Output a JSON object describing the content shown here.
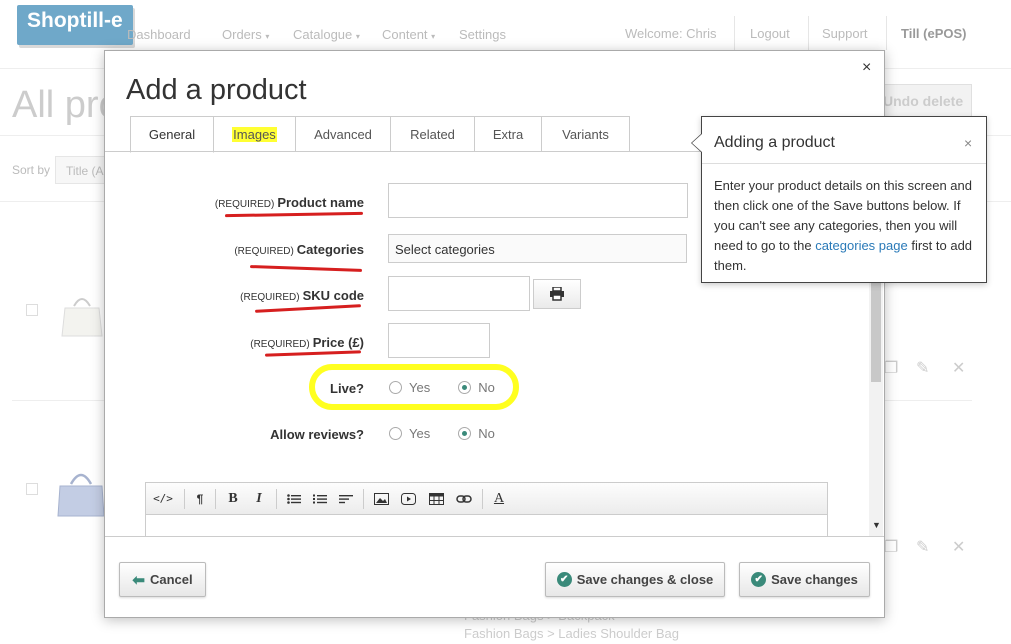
{
  "app": {
    "logo": "Shoptill-e",
    "nav": [
      "Dashboard",
      "Orders",
      "Catalogue",
      "Content",
      "Settings"
    ],
    "nav_dropdown_caret": "▾",
    "welcome": "Welcome: Chris",
    "logout": "Logout",
    "support": "Support",
    "till": "Till (ePOS)",
    "page_title": "All pro",
    "undo_delete": "Undo delete",
    "sort_by_label": "Sort by",
    "sort_value": "Title (A",
    "breadcrumbs": [
      "Fashion Bags > Backpack",
      "Fashion Bags > Ladies Shoulder Bag"
    ]
  },
  "modal": {
    "title": "Add a product",
    "close": "×",
    "tabs": [
      {
        "label": "General",
        "active": true
      },
      {
        "label": "Images",
        "highlight": true
      },
      {
        "label": "Advanced"
      },
      {
        "label": "Related"
      },
      {
        "label": "Extra"
      },
      {
        "label": "Variants"
      }
    ],
    "fields": {
      "required_tag": "(REQUIRED)",
      "product_name_label": "Product name",
      "product_name_value": "",
      "categories_label": "Categories",
      "categories_placeholder": "Select categories",
      "sku_label": "SKU code",
      "sku_value": "",
      "price_label": "Price (£)",
      "price_value": "",
      "live_label": "Live?",
      "live_selected": "No",
      "reviews_label": "Allow reviews?",
      "reviews_selected": "No",
      "yes": "Yes",
      "no": "No"
    },
    "toolbar": [
      "</>",
      "¶",
      "B",
      "I",
      "≔",
      "⒈",
      "≡",
      "image",
      "video",
      "table",
      "link",
      "A"
    ],
    "cancel": "Cancel",
    "save_close": "Save changes & close",
    "save": "Save changes"
  },
  "tooltip": {
    "title": "Adding a product",
    "close": "×",
    "text_before_link": "Enter your product details on this screen and then click one of the Save buttons below. If you can't see any categories, then you will need to go to the ",
    "link": "categories page",
    "text_after_link": " first to add them."
  },
  "colors": {
    "accent_green": "#3a8a7a",
    "annotation_red": "#d61f1f",
    "annotation_yellow": "#ffff20",
    "link_blue": "#2a7ab8"
  }
}
